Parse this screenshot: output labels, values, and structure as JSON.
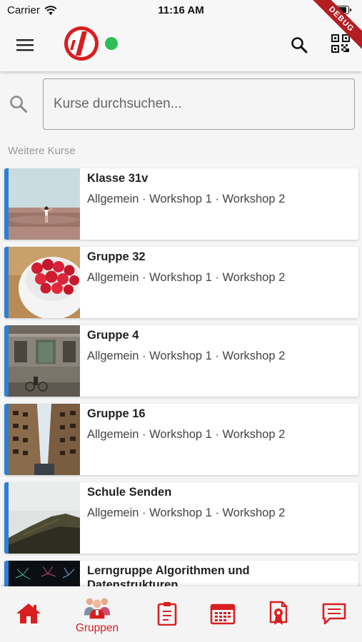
{
  "status_bar": {
    "carrier": "Carrier",
    "time": "11:16 AM"
  },
  "debug_banner": "DEBUG",
  "search": {
    "placeholder": "Kurse durchsuchen..."
  },
  "section_label": "Weitere Kurse",
  "courses": [
    {
      "title": "Klasse 31v",
      "subtitle": "Allgemein · Workshop 1 · Workshop 2",
      "image": "beach-photo"
    },
    {
      "title": "Gruppe 32",
      "subtitle": "Allgemein · Workshop 1 · Workshop 2",
      "image": "raspberries-photo"
    },
    {
      "title": "Gruppe 4",
      "subtitle": "Allgemein · Workshop 1 · Workshop 2",
      "image": "building-photo"
    },
    {
      "title": "Gruppe 16",
      "subtitle": "Allgemein · Workshop 1 · Workshop 2",
      "image": "street-photo"
    },
    {
      "title": "Schule Senden",
      "subtitle": "Allgemein · Workshop 1 · Workshop 2",
      "image": "hill-photo"
    },
    {
      "title": "Lerngruppe Algorithmen und Datenstrukturen",
      "subtitle": "",
      "image": "fireworks-photo"
    }
  ],
  "bottom_nav": {
    "active": "Gruppen",
    "items": [
      {
        "icon": "home-icon",
        "label": ""
      },
      {
        "icon": "groups-icon",
        "label": "Gruppen"
      },
      {
        "icon": "clipboard-icon",
        "label": ""
      },
      {
        "icon": "calendar-icon",
        "label": ""
      },
      {
        "icon": "certificate-icon",
        "label": ""
      },
      {
        "icon": "messages-icon",
        "label": ""
      }
    ]
  },
  "colors": {
    "accent": "#d81e20",
    "card_stripe": "#2f7fd4",
    "online": "#2ebd59"
  }
}
